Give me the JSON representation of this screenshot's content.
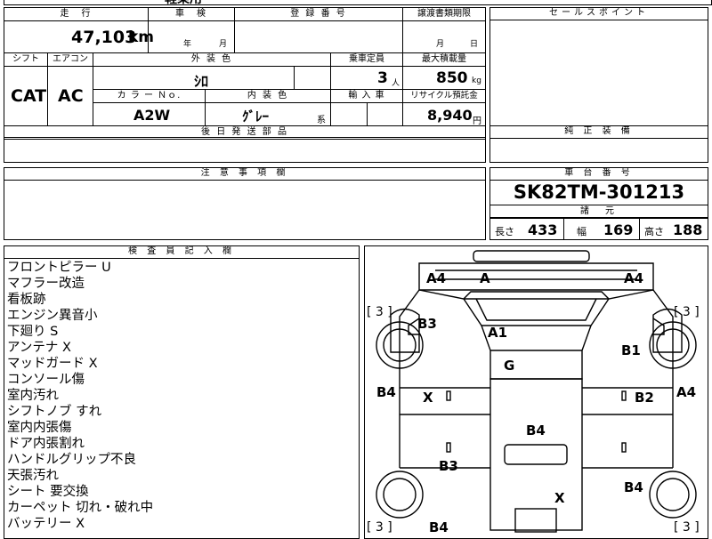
{
  "top_cut": {
    "partial_text": "軽乗用"
  },
  "mileage": {
    "label": "走　行",
    "value": "47,103",
    "unit": "km"
  },
  "inspection": {
    "label": "車　検",
    "year_unit": "年",
    "month_unit": "月"
  },
  "registration": {
    "label": "登 録 番 号"
  },
  "transfer": {
    "label": "譲渡書類期限",
    "month_unit": "月",
    "day_unit": "日"
  },
  "shift": {
    "label": "シフト",
    "value": "CAT"
  },
  "aircon": {
    "label": "エアコン",
    "value": "AC"
  },
  "exterior_color": {
    "label": "外 装 色",
    "value": "ｼﾛ"
  },
  "capacity": {
    "label": "乗車定員",
    "value": "3",
    "unit": "人"
  },
  "max_load": {
    "label": "最大積載量",
    "value": "850",
    "unit": "kg"
  },
  "color_no": {
    "label": "カ ラ ー Ｎｏ.",
    "value": "A2W"
  },
  "interior_color": {
    "label": "内 装 色",
    "value": "ｸﾞﾚｰ",
    "suffix": "系"
  },
  "import": {
    "label": "輸 入 車"
  },
  "recycle": {
    "label": "リサイクル預託金",
    "value": "8,940",
    "unit": "円"
  },
  "later_parts": {
    "label": "後 日 発 送 部 品"
  },
  "sales_point": {
    "label": "セールスポイント"
  },
  "genuine_equipment": {
    "label": "純 正 装 備"
  },
  "caution": {
    "label": "注 意 事 項 欄"
  },
  "chassis": {
    "label": "車 台 番 号",
    "value": "SK82TM-301213"
  },
  "specs": {
    "label": "諸　元",
    "length_label": "長さ",
    "length": "433",
    "width_label": "幅",
    "width": "169",
    "height_label": "高さ",
    "height": "188"
  },
  "inspector": {
    "label": "検 査 員 記 入 欄",
    "notes": [
      "フロントピラー U",
      "マフラー改造",
      "看板跡",
      "エンジン異音小",
      "下廻り S",
      "アンテナ X",
      "マッドガード X",
      "コンソール傷",
      "室内汚れ",
      "シフトノブ すれ",
      "室内内張傷",
      "ドア内張割れ",
      "ハンドルグリップ不良",
      "天張汚れ",
      "シート 要交換",
      "カーペット 切れ・破れ中",
      "バッテリー X"
    ]
  },
  "diagram": {
    "marks": {
      "a4_top_left": "A4",
      "a_top": "A",
      "a4_top_right": "A4",
      "b3_front_left": "B3",
      "a1_windshield": "A1",
      "b1_front_right": "B1",
      "g_roof": "G",
      "b4_left": "B4",
      "x_left_door": "X",
      "b2_right_door": "B2",
      "a4_right": "A4",
      "b4_bed": "B4",
      "b3_rear_left": "B3",
      "x_bed": "X",
      "b4_rear_right": "B4",
      "b4_bottom": "B4"
    },
    "tire_tl": "[ 3 ]",
    "tire_tr": "[ 3 ]",
    "tire_bl": "[ 3 ]",
    "tire_br": "[ 3 ]"
  }
}
